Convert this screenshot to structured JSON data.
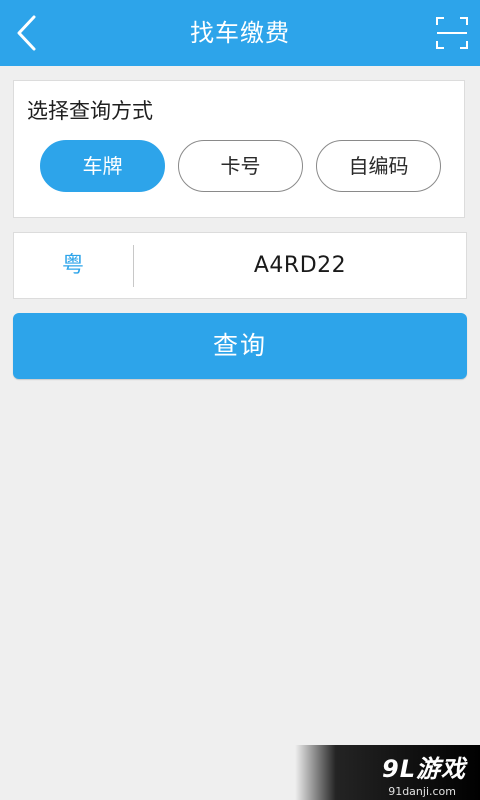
{
  "header": {
    "title": "找车缴费",
    "back_icon": "chevron-left-icon",
    "scan_icon": "scan-frame-icon"
  },
  "query_method": {
    "heading": "选择查询方式",
    "options": [
      {
        "label": "车牌",
        "selected": true
      },
      {
        "label": "卡号",
        "selected": false
      },
      {
        "label": "自编码",
        "selected": false
      }
    ]
  },
  "plate": {
    "province": "粤",
    "number": "A4RD22"
  },
  "search_button": {
    "label": "查询"
  },
  "watermark": {
    "logo": "9L游戏",
    "url": "91danji.com"
  },
  "colors": {
    "accent": "#2da4ea",
    "background": "#efefef"
  }
}
